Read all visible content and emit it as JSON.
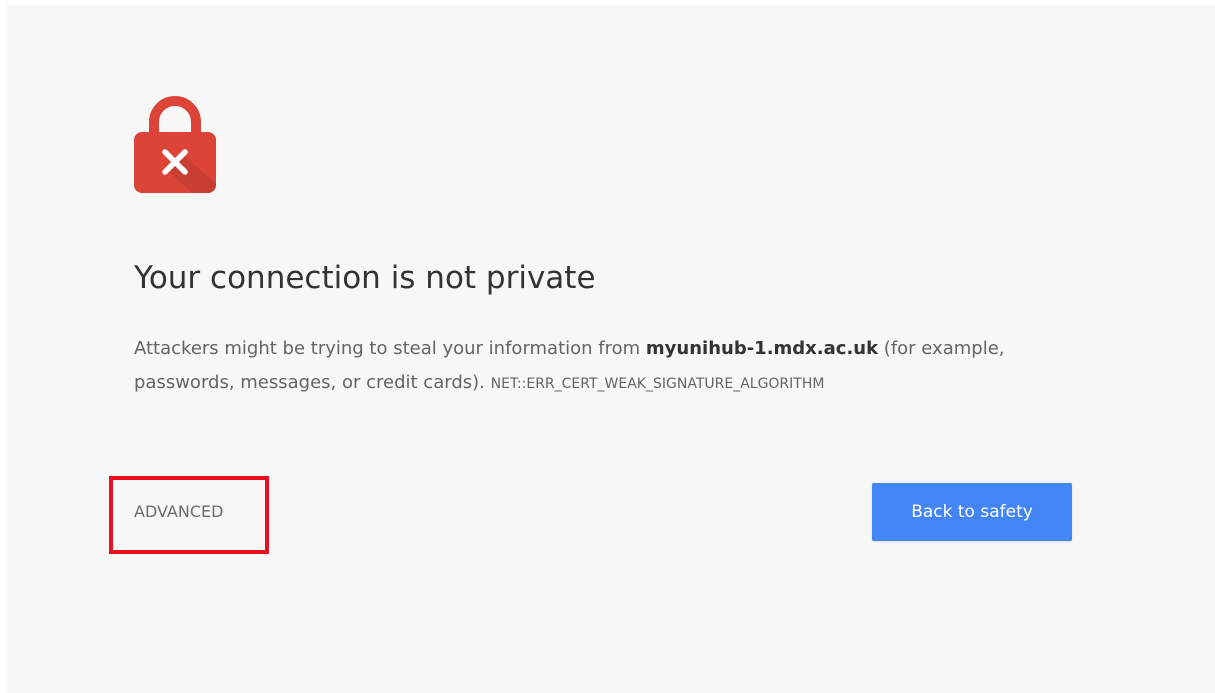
{
  "interstitial": {
    "heading": "Your connection is not private",
    "body_prefix": "Attackers might be trying to steal your information from ",
    "host": "myunihub-1.mdx.ac.uk",
    "body_suffix": " (for example, passwords, messages, or credit cards). ",
    "error_code": "NET::ERR_CERT_WEAK_SIGNATURE_ALGORITHM",
    "icon": "lock-error-icon"
  },
  "actions": {
    "advanced_label": "ADVANCED",
    "back_label": "Back to safety"
  },
  "colors": {
    "page_bg": "#f7f7f7",
    "lock_red": "#db4437",
    "button_blue": "#4285f4",
    "highlight_red": "#e8101e"
  }
}
